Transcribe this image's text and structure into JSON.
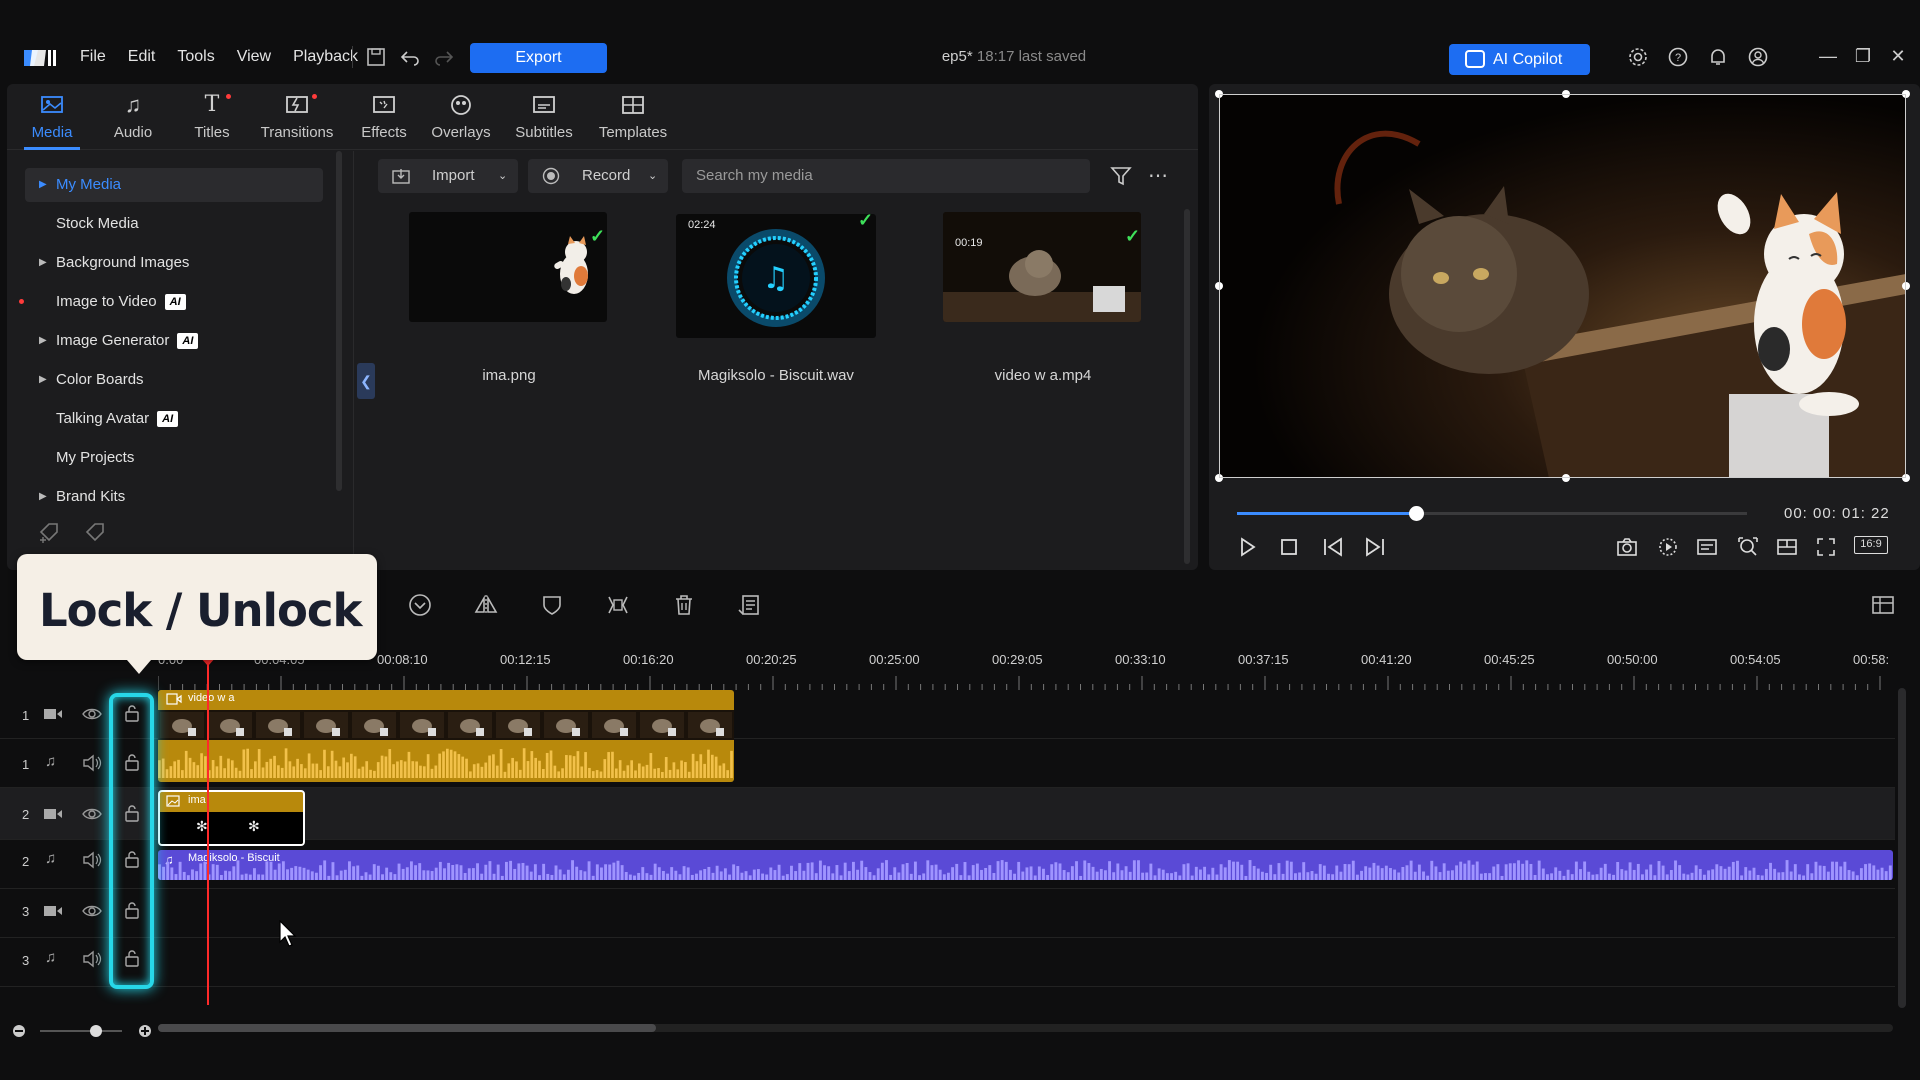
{
  "menu": {
    "items": [
      "File",
      "Edit",
      "Tools",
      "View",
      "Playback"
    ],
    "export_label": "Export"
  },
  "project": {
    "name": "ep5*",
    "saved": "18:17 last saved"
  },
  "copilot_label": "AI Copilot",
  "tabs": [
    {
      "label": "Media",
      "icon": "media-icon"
    },
    {
      "label": "Audio",
      "icon": "music-note-icon"
    },
    {
      "label": "Titles",
      "icon": "text-t-icon"
    },
    {
      "label": "Transitions",
      "icon": "transition-icon"
    },
    {
      "label": "Effects",
      "icon": "effects-icon"
    },
    {
      "label": "Overlays",
      "icon": "overlays-icon"
    },
    {
      "label": "Subtitles",
      "icon": "subtitles-icon"
    },
    {
      "label": "Templates",
      "icon": "templates-icon"
    }
  ],
  "sidebar": {
    "items": [
      {
        "label": "My Media",
        "expandable": true,
        "selected": true
      },
      {
        "label": "Stock Media",
        "expandable": false
      },
      {
        "label": "Background Images",
        "expandable": true
      },
      {
        "label": "Image to Video",
        "expandable": false,
        "badge": "AI"
      },
      {
        "label": "Image Generator",
        "expandable": true,
        "badge": "AI"
      },
      {
        "label": "Color Boards",
        "expandable": true
      },
      {
        "label": "Talking Avatar",
        "expandable": false,
        "badge": "AI"
      },
      {
        "label": "My Projects",
        "expandable": false
      },
      {
        "label": "Brand Kits",
        "expandable": true
      }
    ]
  },
  "media_toolbar": {
    "import_label": "Import",
    "record_label": "Record",
    "search_placeholder": "Search my media"
  },
  "media": [
    {
      "name": "ima.png",
      "type": "image",
      "duration": ""
    },
    {
      "name": "Magiksolo - Biscuit.wav",
      "type": "audio",
      "duration": "02:24"
    },
    {
      "name": "video w a.mp4",
      "type": "video",
      "duration": "00:19"
    }
  ],
  "preview": {
    "timecode": "00: 00: 01: 22",
    "progress": 0.35,
    "aspect": "16:9"
  },
  "callout": {
    "text": "Lock / Unlock"
  },
  "ruler": {
    "labels": [
      "0:00",
      "00:04:05",
      "00:08:10",
      "00:12:15",
      "00:16:20",
      "00:20:25",
      "00:25:00",
      "00:29:05",
      "00:33:10",
      "00:37:15",
      "00:41:20",
      "00:45:25",
      "00:50:00",
      "00:54:05",
      "00:58:"
    ]
  },
  "tracks": [
    {
      "num": "1",
      "kind": "video"
    },
    {
      "num": "1",
      "kind": "audio"
    },
    {
      "num": "2",
      "kind": "video"
    },
    {
      "num": "2",
      "kind": "audio"
    },
    {
      "num": "3",
      "kind": "video"
    },
    {
      "num": "3",
      "kind": "audio"
    }
  ],
  "clips": {
    "video1": "video w a",
    "image2": "ima",
    "audio2": "Magiksolo - Biscuit"
  },
  "colors": {
    "accent": "#1d6df2",
    "video_clip": "#b8890c",
    "audio_clip": "#5a4ad6",
    "lock_highlight": "#27d7e8",
    "playhead": "#ff2a2a"
  }
}
